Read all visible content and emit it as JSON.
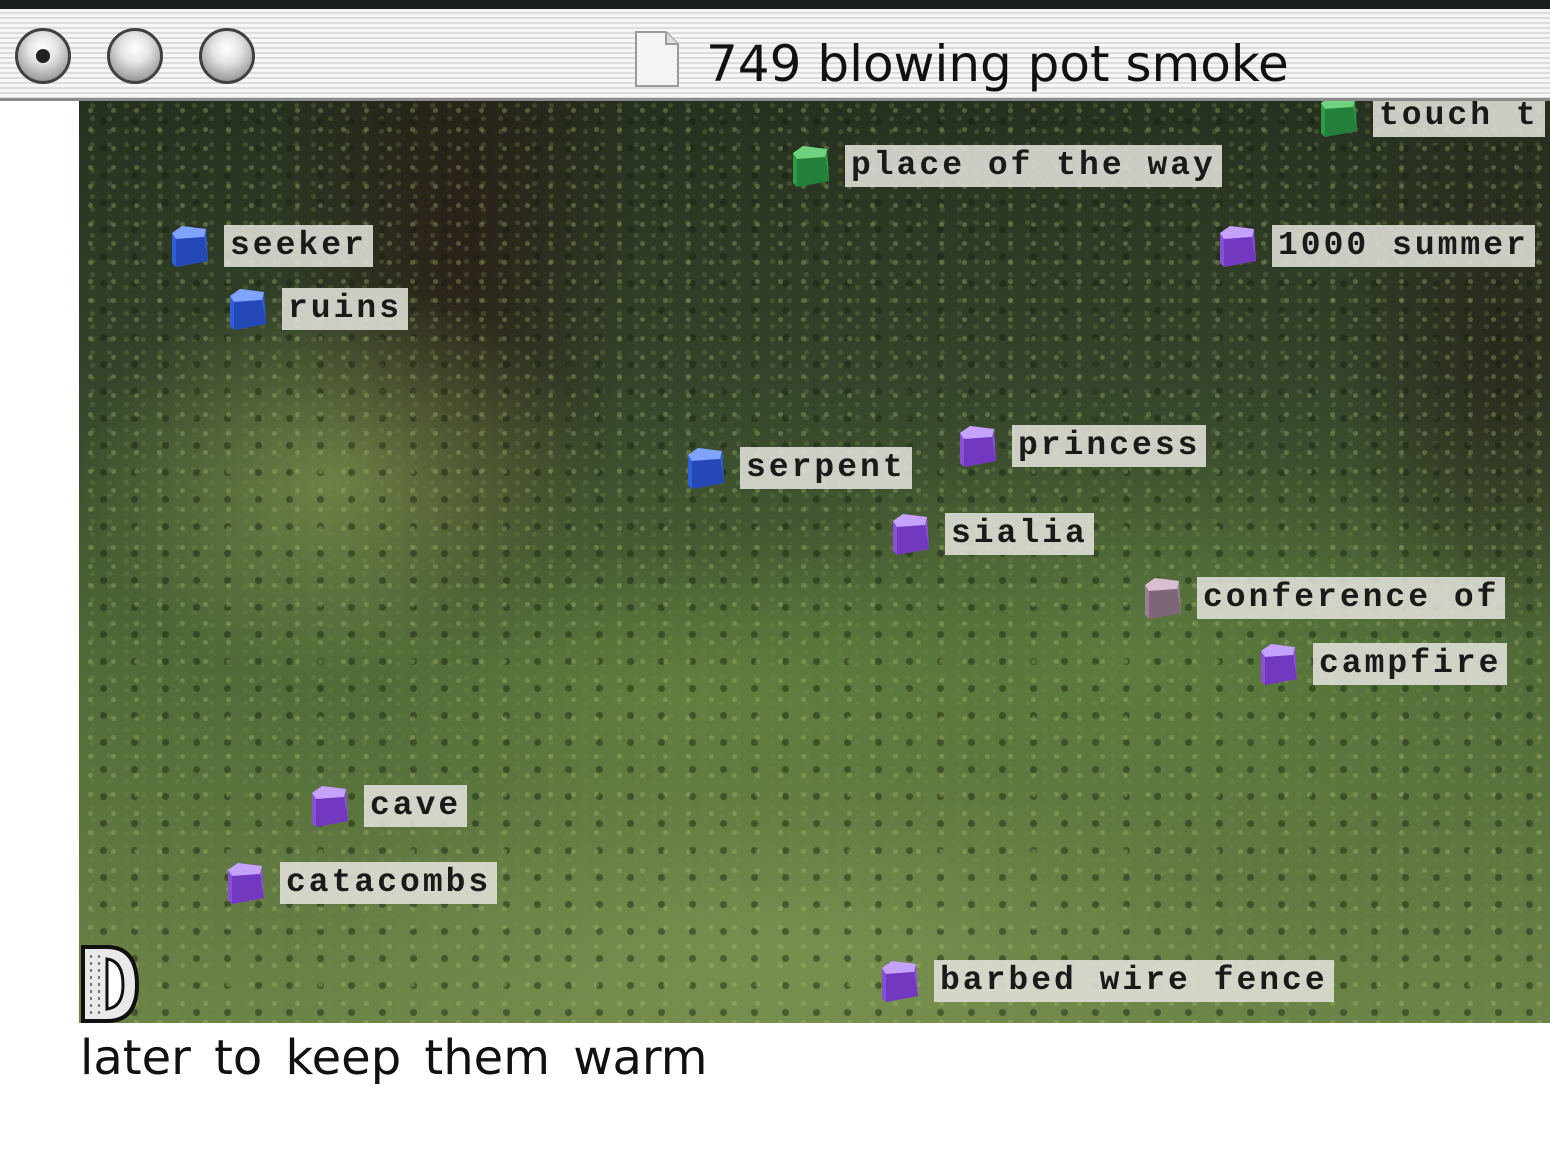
{
  "window": {
    "title": "749 blowing pot smoke"
  },
  "colors": {
    "folder_blue": "#2f5fd8",
    "folder_purple": "#8a4fd6",
    "folder_green": "#2f9a45",
    "folder_mauve": "#9a8094"
  },
  "nodes": [
    {
      "label": "touch t",
      "color": "green",
      "icon": "folder-icon"
    },
    {
      "label": "place of the way",
      "color": "green",
      "icon": "folder-icon"
    },
    {
      "label": "seeker",
      "color": "blue",
      "icon": "folder-icon"
    },
    {
      "label": "1000 summer",
      "color": "purple",
      "icon": "folder-icon"
    },
    {
      "label": "ruins",
      "color": "blue",
      "icon": "folder-icon"
    },
    {
      "label": "princess",
      "color": "purple",
      "icon": "folder-icon"
    },
    {
      "label": "serpent",
      "color": "blue",
      "icon": "folder-icon"
    },
    {
      "label": "sialia",
      "color": "purple",
      "icon": "folder-icon"
    },
    {
      "label": "conference of",
      "color": "mauve",
      "icon": "folder-icon"
    },
    {
      "label": "campfire",
      "color": "purple",
      "icon": "folder-icon"
    },
    {
      "label": "cave",
      "color": "purple",
      "icon": "folder-icon"
    },
    {
      "label": "catacombs",
      "color": "purple",
      "icon": "folder-icon"
    },
    {
      "label": "barbed wire fence",
      "color": "purple",
      "icon": "folder-icon"
    }
  ],
  "caption": "later to keep them warm"
}
